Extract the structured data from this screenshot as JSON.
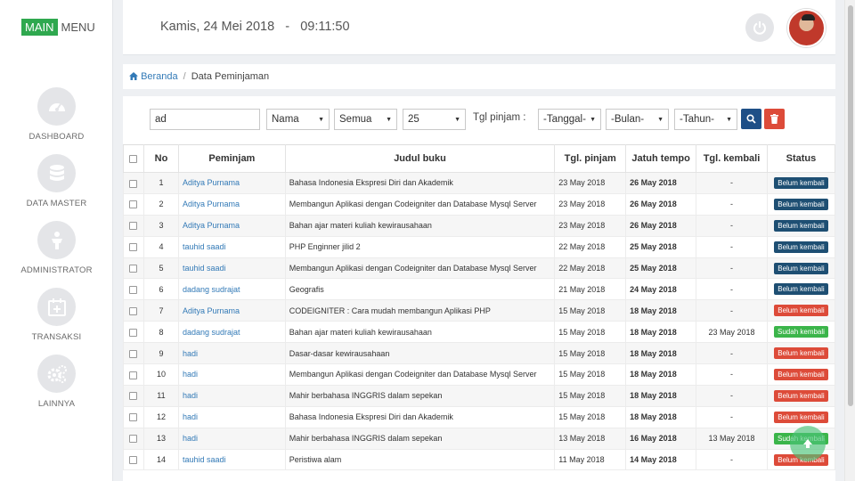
{
  "brand": {
    "main": "MAIN",
    "menu": "MENU"
  },
  "sidebar": {
    "items": [
      {
        "label": "DASHBOARD",
        "icon": "speedometer-icon"
      },
      {
        "label": "DATA MASTER",
        "icon": "database-icon"
      },
      {
        "label": "ADMINISTRATOR",
        "icon": "user-icon"
      },
      {
        "label": "TRANSAKSI",
        "icon": "calendar-plus-icon"
      },
      {
        "label": "LAINNYA",
        "icon": "gears-icon"
      }
    ]
  },
  "header": {
    "date": "Kamis, 24 Mei 2018",
    "separator": "-",
    "time": "09:11:50"
  },
  "breadcrumb": {
    "home": "Beranda",
    "sep": "/",
    "current": "Data Peminjaman"
  },
  "filters": {
    "search_value": "ad",
    "field": "Nama",
    "status": "Semua",
    "per_page": "25",
    "date_label": "Tgl pinjam :",
    "day": "-Tanggal-",
    "month": "-Bulan-",
    "year": "-Tahun-"
  },
  "table": {
    "headers": [
      "No",
      "Peminjam",
      "Judul buku",
      "Tgl. pinjam",
      "Jatuh tempo",
      "Tgl. kembali",
      "Status"
    ],
    "rows": [
      {
        "no": "1",
        "peminjam": "Aditya Purnama",
        "judul": "Bahasa Indonesia Ekspresi Diri dan Akademik",
        "tgl": "23 May 2018",
        "jatuh": "26 May 2018",
        "kembali": "-",
        "status": "Belum kembali",
        "color": "#1e4f73"
      },
      {
        "no": "2",
        "peminjam": "Aditya Purnama",
        "judul": "Membangun Aplikasi dengan Codeigniter dan Database Mysql Server",
        "tgl": "23 May 2018",
        "jatuh": "26 May 2018",
        "kembali": "-",
        "status": "Belum kembali",
        "color": "#1e4f73"
      },
      {
        "no": "3",
        "peminjam": "Aditya Purnama",
        "judul": "Bahan ajar materi kuliah kewirausahaan",
        "tgl": "23 May 2018",
        "jatuh": "26 May 2018",
        "kembali": "-",
        "status": "Belum kembali",
        "color": "#1e4f73"
      },
      {
        "no": "4",
        "peminjam": "tauhid saadi",
        "judul": "PHP Enginner jilid 2",
        "tgl": "22 May 2018",
        "jatuh": "25 May 2018",
        "kembali": "-",
        "status": "Belum kembali",
        "color": "#1e4f73"
      },
      {
        "no": "5",
        "peminjam": "tauhid saadi",
        "judul": "Membangun Aplikasi dengan Codeigniter dan Database Mysql Server",
        "tgl": "22 May 2018",
        "jatuh": "25 May 2018",
        "kembali": "-",
        "status": "Belum kembali",
        "color": "#1e4f73"
      },
      {
        "no": "6",
        "peminjam": "dadang sudrajat",
        "judul": "Geografis",
        "tgl": "21 May 2018",
        "jatuh": "24 May 2018",
        "kembali": "-",
        "status": "Belum kembali",
        "color": "#1e4f73"
      },
      {
        "no": "7",
        "peminjam": "Aditya Purnama",
        "judul": "CODEIGNITER : Cara mudah membangun Aplikasi PHP",
        "tgl": "15 May 2018",
        "jatuh": "18 May 2018",
        "kembali": "-",
        "status": "Belum kembali",
        "color": "#dd4b39"
      },
      {
        "no": "8",
        "peminjam": "dadang sudrajat",
        "judul": "Bahan ajar materi kuliah kewirausahaan",
        "tgl": "15 May 2018",
        "jatuh": "18 May 2018",
        "kembali": "23 May 2018",
        "status": "Sudah kembali",
        "color": "#3bb54a"
      },
      {
        "no": "9",
        "peminjam": "hadi",
        "judul": "Dasar-dasar kewirausahaan",
        "tgl": "15 May 2018",
        "jatuh": "18 May 2018",
        "kembali": "-",
        "status": "Belum kembali",
        "color": "#dd4b39"
      },
      {
        "no": "10",
        "peminjam": "hadi",
        "judul": "Membangun Aplikasi dengan Codeigniter dan Database Mysql Server",
        "tgl": "15 May 2018",
        "jatuh": "18 May 2018",
        "kembali": "-",
        "status": "Belum kembali",
        "color": "#dd4b39"
      },
      {
        "no": "11",
        "peminjam": "hadi",
        "judul": "Mahir berbahasa INGGRIS dalam sepekan",
        "tgl": "15 May 2018",
        "jatuh": "18 May 2018",
        "kembali": "-",
        "status": "Belum kembali",
        "color": "#dd4b39"
      },
      {
        "no": "12",
        "peminjam": "hadi",
        "judul": "Bahasa Indonesia Ekspresi Diri dan Akademik",
        "tgl": "15 May 2018",
        "jatuh": "18 May 2018",
        "kembali": "-",
        "status": "Belum kembali",
        "color": "#dd4b39"
      },
      {
        "no": "13",
        "peminjam": "hadi",
        "judul": "Mahir berbahasa INGGRIS dalam sepekan",
        "tgl": "13 May 2018",
        "jatuh": "16 May 2018",
        "kembali": "13 May 2018",
        "status": "Sudah kembali",
        "color": "#3bb54a"
      },
      {
        "no": "14",
        "peminjam": "tauhid saadi",
        "judul": "Peristiwa alam",
        "tgl": "11 May 2018",
        "jatuh": "14 May 2018",
        "kembali": "-",
        "status": "Belum kembali",
        "color": "#dd4b39"
      }
    ]
  }
}
